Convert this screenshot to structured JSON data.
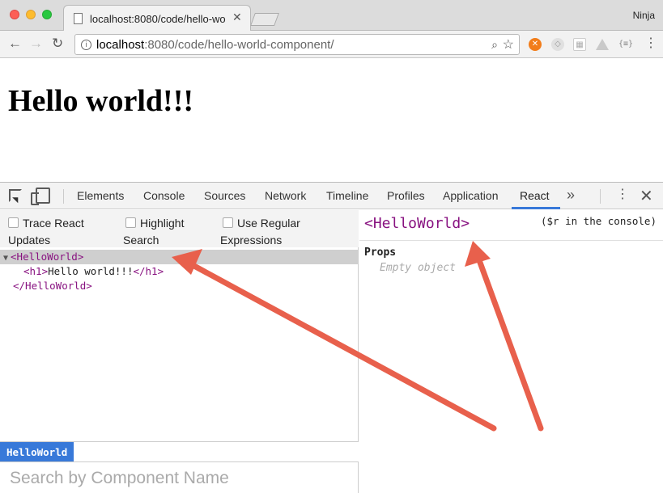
{
  "browser": {
    "tab_title": "localhost:8080/code/hello-wo",
    "tab_close_glyph": "✕",
    "profile_name": "Ninja",
    "url_host": "localhost",
    "url_rest": ":8080/code/hello-world-component/",
    "extension_icons": [
      "avast-icon",
      "gray-extension-icon",
      "grid-extension-icon",
      "drive-icon",
      "json-formatter-icon"
    ],
    "ext5_label": "{≡}"
  },
  "page": {
    "heading": "Hello world!!!"
  },
  "devtools": {
    "tabs": [
      "Elements",
      "Console",
      "Sources",
      "Network",
      "Timeline",
      "Profiles",
      "Application",
      "React"
    ],
    "active_tab": "React",
    "accent_color": "#3879d9",
    "options": {
      "trace_line1": "Trace React",
      "trace_line2": "Updates",
      "highlight_line1": "Highlight",
      "highlight_line2": "Search",
      "regex_line1": "Use Regular",
      "regex_line2": "Expressions"
    },
    "tree": {
      "root_open": "<HelloWorld>",
      "child_open_tag": "<h1>",
      "child_text": "Hello world!!!",
      "child_close_tag": "</h1>",
      "root_close": "</HelloWorld>"
    },
    "breadcrumb": "HelloWorld",
    "search_placeholder": "Search by Component Name",
    "side": {
      "component_name": "<HelloWorld>",
      "console_hint": "($r in the console)",
      "props_title": "Props",
      "props_empty": "Empty object"
    },
    "tag_color": "#881280"
  },
  "annotation": {
    "arrow_color": "#e8604c"
  }
}
